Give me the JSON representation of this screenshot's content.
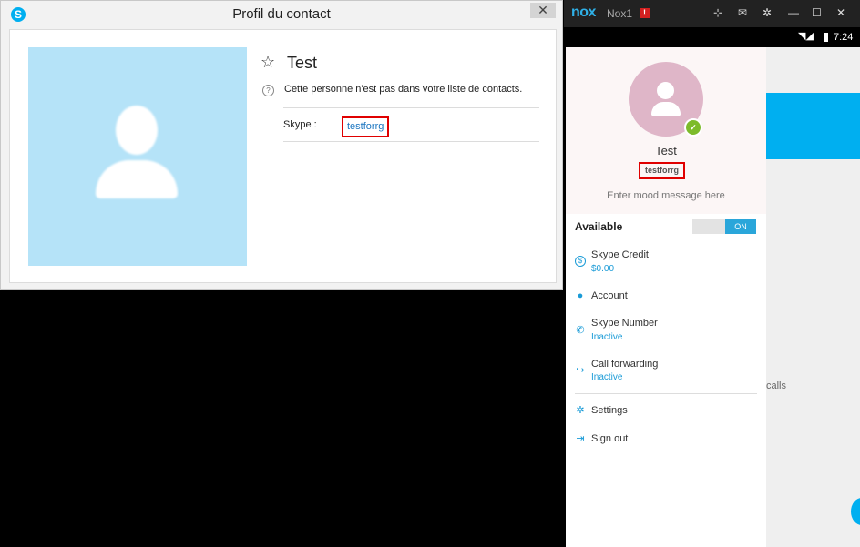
{
  "profile_window": {
    "title": "Profil du contact",
    "close_glyph": "✕",
    "contact_name": "Test",
    "not_in_contacts": "Cette personne n'est pas dans votre liste de contacts.",
    "skype_label": "Skype :",
    "skype_username": "testforrg"
  },
  "nox": {
    "logo": "nox",
    "instance_name": "Nox1",
    "alert_glyph": "!",
    "status_time": "7:24"
  },
  "drawer": {
    "display_name": "Test",
    "username": "testforrg",
    "mood_placeholder": "Enter mood message here",
    "available_label": "Available",
    "toggle_state": "ON",
    "items": [
      {
        "label": "Skype Credit",
        "sub": "$0.00",
        "icon": "credit-icon"
      },
      {
        "label": "Account",
        "sub": "",
        "icon": "person-icon"
      },
      {
        "label": "Skype Number",
        "sub": "Inactive",
        "icon": "phone-icon"
      },
      {
        "label": "Call forwarding",
        "sub": "Inactive",
        "icon": "call-forward-icon"
      },
      {
        "label": "Settings",
        "sub": "",
        "icon": "gear-icon"
      },
      {
        "label": "Sign out",
        "sub": "",
        "icon": "sign-out-icon"
      }
    ]
  },
  "background_app": {
    "calls_text": "calls"
  },
  "colors": {
    "skype_blue": "#00aff0",
    "link_blue": "#1a75c0",
    "highlight_red": "#e00000",
    "presence_green": "#7dbb2b"
  }
}
